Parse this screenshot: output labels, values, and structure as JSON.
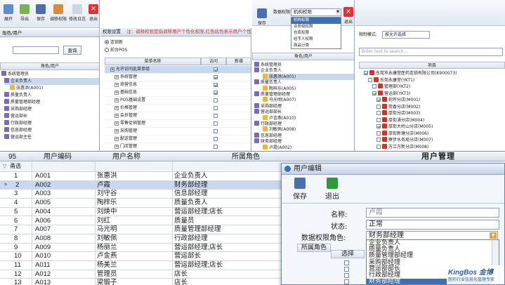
{
  "w1": {
    "toolbar": [
      "展开",
      "导出",
      "保存",
      "调移权限",
      "修改日志",
      "退出"
    ],
    "tab": "角色/用户",
    "search_btn": "查询",
    "col": "角色/用户",
    "tree": [
      "系统管理员",
      "企业负责人",
      "张惠洪(A001)",
      "质量负责人",
      "质量管理部经理",
      "采购部经理",
      "营运部长",
      "行政部经理",
      "信息部经理",
      "营运部主任"
    ]
  },
  "w2": {
    "tab": "权限设置",
    "note": "注：调移权限是指调移用户个性化权限,红色底色表示用户个性化权限的",
    "radio1": "连锁新",
    "radio2": "前台POS",
    "h_name": "菜单名称",
    "h_visit": "访问",
    "h_new": "新增",
    "rows": [
      "允许访问此菜单组",
      "系统管理",
      "商营信息",
      "基础信息",
      "POS基础设置",
      "价格管理",
      "会员管理",
      "零售促销管理",
      "采购管理",
      "配送管理",
      "门店管理"
    ]
  },
  "w3": {
    "save": "保存",
    "exit": "退出",
    "label": "数据权限:",
    "select_val": "机构权限",
    "options": [
      "机构权限",
      "业务组权限",
      "仓库权限",
      "经手人权限",
      "商品分类"
    ],
    "col": "角色/用户",
    "tree": [
      "系统管理员",
      "企业负责人",
      "张惠洪(A001)",
      "质量负责人",
      "陶梓乐(A005)",
      "质量管理部经理",
      "马光明(A007)",
      "采购部经理",
      "营运部部长",
      "卢金燕(A010)",
      "行政部经理",
      "刘敏佩(A008)",
      "信息部经理",
      "财务部经理",
      "卢霞(A002)"
    ]
  },
  "w4": {
    "mode_label": "限制模式:",
    "mode_val": "按允许选择",
    "search_ph": "Enter text to search...",
    "col": "项目",
    "tree": [
      "东莞市永康堂医药连锁有限公司(K900073)",
      "东莞永康堂(YKT1)",
      "管理部(YKT2)",
      "营运部(YKT3)",
      "何坪分店(M001)",
      "莞香分店(M002)",
      "厚街分店(M003)",
      "厚街涌分店(M004)",
      "厚街大岭山分店(M005)",
      "厚街新塘分店(M006)",
      "寮步水务局分店(M007)",
      "万江万新分店(M008)"
    ]
  },
  "w5": {
    "count": "95",
    "h_code": "用户编码",
    "h_name": "用户名称",
    "h_role": "所属角色",
    "filter": "甬选",
    "title": "用户管理",
    "rows": [
      {
        "n": "1",
        "code": "A001",
        "name": "张惠洪",
        "role": "企业负责人"
      },
      {
        "n": "2",
        "code": "A002",
        "name": "卢霞",
        "role": "财务部经理"
      },
      {
        "n": "3",
        "code": "A003",
        "name": "刘守谷",
        "role": "信息部经理"
      },
      {
        "n": "4",
        "code": "A005",
        "name": "陶梓乐",
        "role": "质量负责人"
      },
      {
        "n": "5",
        "code": "A004",
        "name": "刘焕中",
        "role": "营运部经理;店长"
      },
      {
        "n": "6",
        "code": "A006",
        "name": "刘红",
        "role": "质量员"
      },
      {
        "n": "7",
        "code": "A007",
        "name": "马光明",
        "role": "质量管理部经理"
      },
      {
        "n": "8",
        "code": "A008",
        "name": "刘敏佩",
        "role": "行政部经理"
      },
      {
        "n": "9",
        "code": "A009",
        "name": "杨丽兰",
        "role": "营运部经理;店长"
      },
      {
        "n": "10",
        "code": "A010",
        "name": "卢金燕",
        "role": "营运部长"
      },
      {
        "n": "11",
        "code": "A011",
        "name": "杨美兰",
        "role": "营运部经理;店长"
      },
      {
        "n": "12",
        "code": "A012",
        "name": "管理员",
        "role": "店长"
      },
      {
        "n": "13",
        "code": "A013",
        "name": "梁锻子",
        "role": "店长"
      },
      {
        "n": "14",
        "code": "A014",
        "name": "和翠管理",
        "role": "店长"
      }
    ]
  },
  "dlg": {
    "title": "用户编辑",
    "save": "保存",
    "exit": "退出",
    "name_label": "名称:",
    "name_val": "卢霞",
    "status_label": "状态:",
    "status_val": "正常",
    "role_label": "数据权限角色:",
    "role_val": "财务部经理",
    "grid_h1": "所属角色",
    "grid_h2": "选择",
    "options": [
      "企业负责人",
      "质量负责人",
      "质量管理部经理",
      "采购部经理",
      "营运部部长",
      "行政部经理",
      "财务部经理"
    ],
    "brand": "KingBos 金博",
    "slogan": "医药行业信息化管理专家"
  },
  "colors": {
    "accent": "#2f5fa8",
    "selection": "#c9d7ef",
    "header": "#dde3ec",
    "red": "#c0392b"
  }
}
